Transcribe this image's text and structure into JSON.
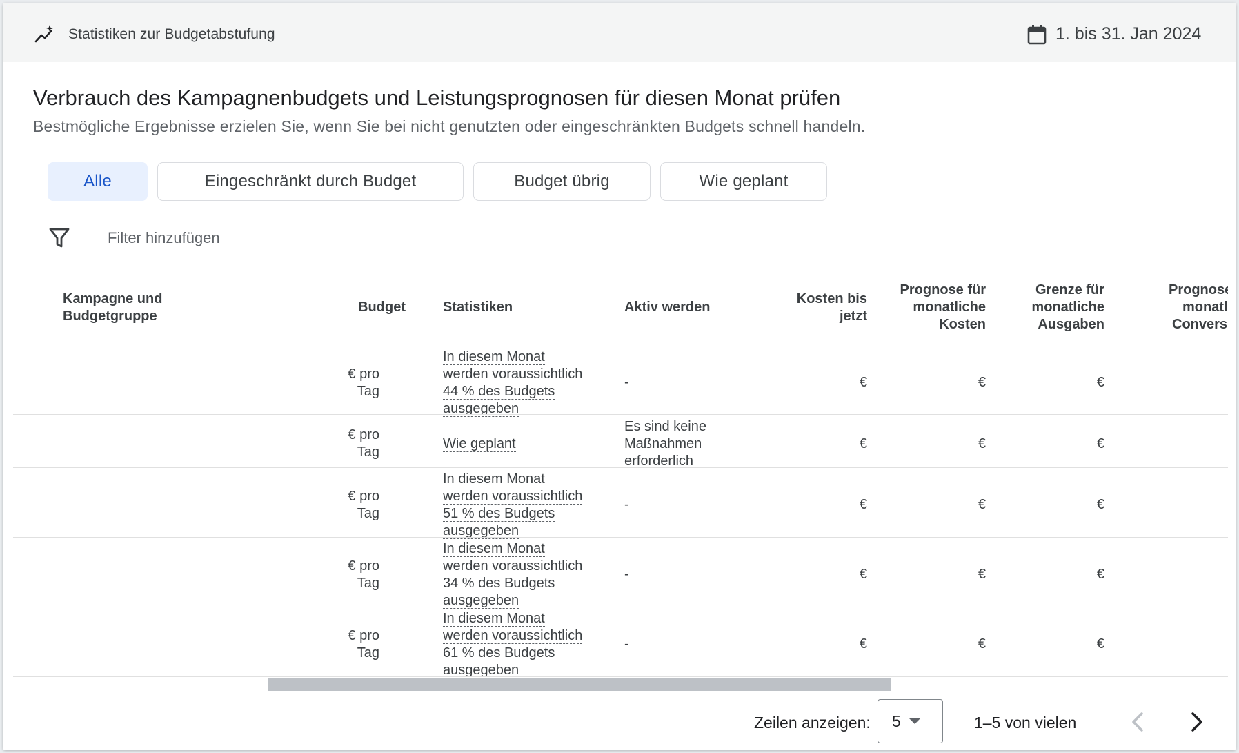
{
  "header": {
    "title": "Statistiken zur Budgetabstufung",
    "date_range": "1. bis 31. Jan 2024"
  },
  "main": {
    "title": "Verbrauch des Kampagnenbudgets und Leistungsprognosen für diesen Monat prüfen",
    "subtitle": "Bestmögliche Ergebnisse erzielen Sie, wenn Sie bei nicht genutzten oder eingeschränkten Budgets schnell handeln."
  },
  "chips": [
    {
      "label": "Alle",
      "active": true
    },
    {
      "label": "Eingeschränkt durch Budget",
      "active": false
    },
    {
      "label": "Budget übrig",
      "active": false
    },
    {
      "label": "Wie geplant",
      "active": false
    }
  ],
  "filter": {
    "label": "Filter hinzufügen"
  },
  "table": {
    "columns": {
      "campaign": [
        "Kampagne und",
        "Budgetgruppe"
      ],
      "budget": [
        "Budget"
      ],
      "stats": [
        "Statistiken"
      ],
      "action": [
        "Aktiv werden"
      ],
      "cost_to_date": [
        "Kosten bis",
        "jetzt"
      ],
      "forecast_cost": [
        "Prognose für",
        "monatliche",
        "Kosten"
      ],
      "spend_limit": [
        "Grenze für",
        "monatliche",
        "Ausgaben"
      ],
      "forecast_conv": [
        "Prognose",
        "monatl",
        "Convers"
      ]
    },
    "rows": [
      {
        "budget": [
          "€ pro",
          "Tag"
        ],
        "stats": [
          "In diesem Monat",
          "werden voraussichtlich",
          "44 % des Budgets",
          "ausgegeben"
        ],
        "action": [
          "-"
        ],
        "cost_to_date": "€",
        "forecast_cost": "€",
        "spend_limit": "€"
      },
      {
        "budget": [
          "€ pro",
          "Tag"
        ],
        "stats": [
          "Wie geplant"
        ],
        "action": [
          "Es sind keine",
          "Maßnahmen",
          "erforderlich"
        ],
        "cost_to_date": "€",
        "forecast_cost": "€",
        "spend_limit": "€"
      },
      {
        "budget": [
          "€ pro",
          "Tag"
        ],
        "stats": [
          "In diesem Monat",
          "werden voraussichtlich",
          "51 % des Budgets",
          "ausgegeben"
        ],
        "action": [
          "-"
        ],
        "cost_to_date": "€",
        "forecast_cost": "€",
        "spend_limit": "€"
      },
      {
        "budget": [
          "€ pro",
          "Tag"
        ],
        "stats": [
          "In diesem Monat",
          "werden voraussichtlich",
          "34 % des Budgets",
          "ausgegeben"
        ],
        "action": [
          "-"
        ],
        "cost_to_date": "€",
        "forecast_cost": "€",
        "spend_limit": "€"
      },
      {
        "budget": [
          "€ pro",
          "Tag"
        ],
        "stats": [
          "In diesem Monat",
          "werden voraussichtlich",
          "61 % des Budgets",
          "ausgegeben"
        ],
        "action": [
          "-"
        ],
        "cost_to_date": "€",
        "forecast_cost": "€",
        "spend_limit": "€"
      }
    ]
  },
  "footer": {
    "rows_label": "Zeilen anzeigen:",
    "rows_value": "5",
    "range": "1–5 von vielen"
  }
}
